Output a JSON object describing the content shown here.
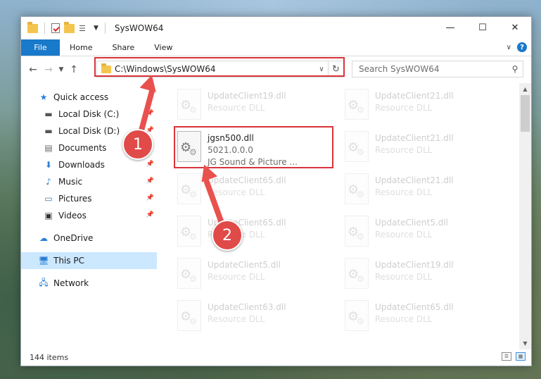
{
  "window": {
    "title": "SysWOW64",
    "controls": {
      "minimize": "—",
      "maximize": "☐",
      "close": "✕"
    }
  },
  "ribbon": {
    "tabs": [
      "File",
      "Home",
      "Share",
      "View"
    ],
    "help": "?"
  },
  "navigation": {
    "address": "C:\\Windows\\SysWOW64",
    "search_placeholder": "Search SysWOW64"
  },
  "sidebar": {
    "quick_access": "Quick access",
    "items": [
      {
        "label": "Local Disk (C:)",
        "icon": "drive-icon",
        "pinned": true
      },
      {
        "label": "Local Disk (D:)",
        "icon": "drive-icon",
        "pinned": true
      },
      {
        "label": "Documents",
        "icon": "documents-icon",
        "pinned": true
      },
      {
        "label": "Downloads",
        "icon": "downloads-icon",
        "pinned": true
      },
      {
        "label": "Music",
        "icon": "music-icon",
        "pinned": true
      },
      {
        "label": "Pictures",
        "icon": "pictures-icon",
        "pinned": true
      },
      {
        "label": "Videos",
        "icon": "videos-icon",
        "pinned": true
      }
    ],
    "onedrive": "OneDrive",
    "this_pc": "This PC",
    "network": "Network"
  },
  "files": {
    "highlighted": {
      "name": "jgsn500.dll",
      "version": "5021.0.0.0",
      "description": "JG Sound & Picture ..."
    },
    "left": [
      {
        "name": "UpdateClient19.dll",
        "sub": "Resource DLL"
      },
      {
        "name": "UpdateClient65.dll",
        "sub": "Resource DLL"
      },
      {
        "name": "UpdateClient65.dll",
        "sub": "Resource DLL"
      },
      {
        "name": "UpdateClient5.dll",
        "sub": "Resource DLL"
      },
      {
        "name": "UpdateClient63.dll",
        "sub": "Resource DLL"
      }
    ],
    "right": [
      {
        "name": "UpdateClient21.dll",
        "sub": "Resource DLL"
      },
      {
        "name": "UpdateClient21.dll",
        "sub": "Resource DLL"
      },
      {
        "name": "UpdateClient21.dll",
        "sub": "Resource DLL"
      },
      {
        "name": "UpdateClient5.dll",
        "sub": "Resource DLL"
      },
      {
        "name": "UpdateClient19.dll",
        "sub": "Resource DLL"
      },
      {
        "name": "UpdateClient65.dll",
        "sub": "Resource DLL"
      }
    ]
  },
  "status": {
    "item_count": "144 items"
  },
  "annotations": {
    "step1": "1",
    "step2": "2",
    "color": "#e04a48"
  }
}
